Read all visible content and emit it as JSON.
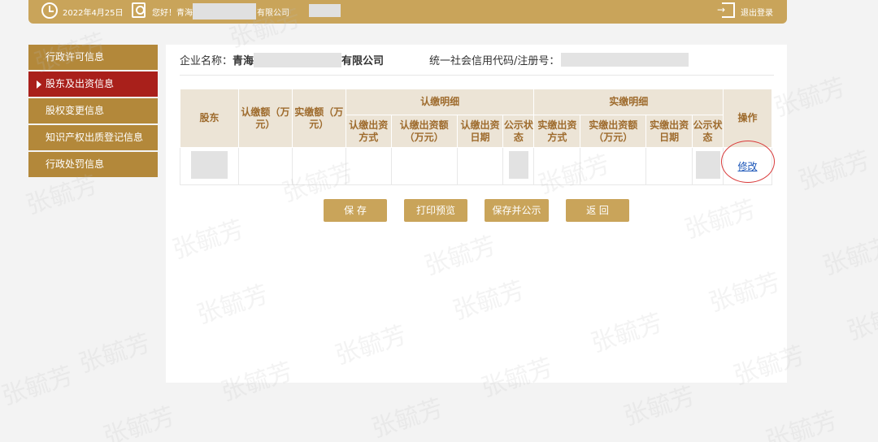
{
  "topbar": {
    "date": "2022年4月25日",
    "greeting": "您好！青海",
    "company_suffix": "有限公司",
    "logout": "退出登录"
  },
  "sidebar": {
    "items": [
      {
        "label": "行政许可信息"
      },
      {
        "label": "股东及出资信息"
      },
      {
        "label": "股权变更信息"
      },
      {
        "label": "知识产权出质登记信息"
      },
      {
        "label": "行政处罚信息"
      }
    ]
  },
  "info": {
    "company_label": "企业名称：",
    "company_prefix": "青海",
    "company_suffix": "有限公司",
    "credit_label": "统一社会信用代码/注册号："
  },
  "table": {
    "h_shareholder": "股东",
    "h_subscribed": "认缴额（万元）",
    "h_paid": "实缴额（万元）",
    "h_sub_detail": "认缴明细",
    "h_paid_detail": "实缴明细",
    "h_action": "操作",
    "sub_cols": [
      "认缴出资方式",
      "认缴出资额（万元）",
      "认缴出资日期",
      "公示状态"
    ],
    "paid_cols": [
      "实缴出资方式",
      "实缴出资额（万元）",
      "实缴出资日期",
      "公示状态"
    ],
    "row_action": "修改"
  },
  "buttons": {
    "save": "保 存",
    "print": "打印预览",
    "save_publish": "保存并公示",
    "back": "返 回"
  },
  "watermark": "张毓芳",
  "colors": {
    "gold": "#c9a45a",
    "sidebar": "#b3883a",
    "active": "#a9201b",
    "header_bg": "#ece4d6",
    "header_text": "#9e6b2d"
  }
}
